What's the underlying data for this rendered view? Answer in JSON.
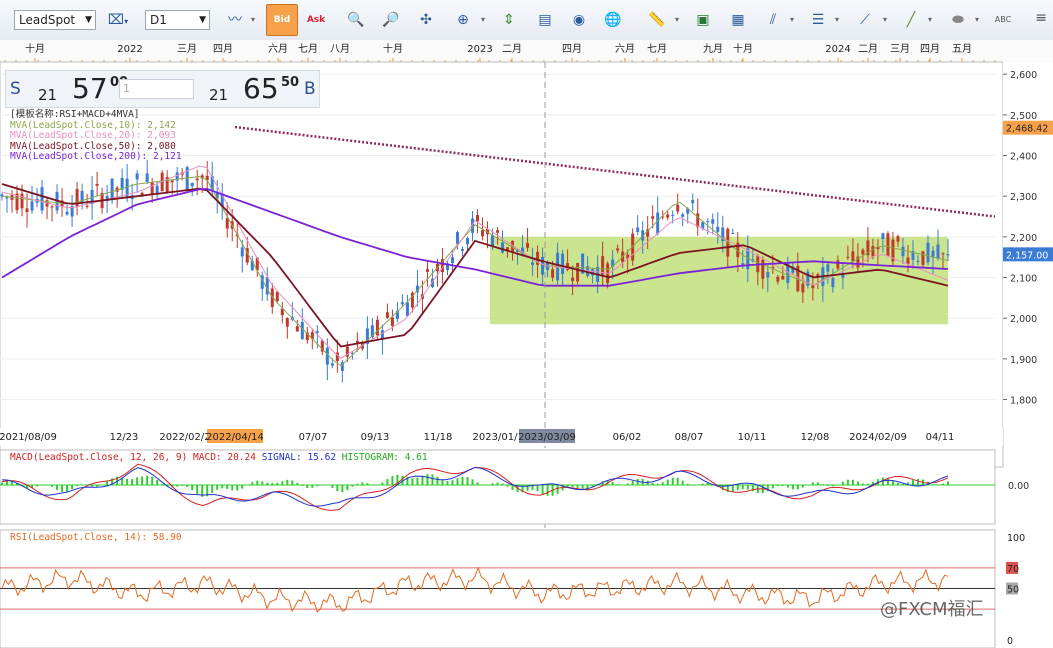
{
  "toolbar": {
    "symbol": "LeadSpot",
    "timeframe": "D1",
    "bid_label": "Bid",
    "ask_label": "Ask",
    "icons": [
      "symbol-combo",
      "draw-combo",
      "line-chart-icon",
      "bid-button",
      "ask-button",
      "zoom-in-icon",
      "zoom-out-icon",
      "crosshair-icon",
      "indicator-icon",
      "navigate-icon",
      "template-icon",
      "eye-icon",
      "globe-icon",
      "ruler-icon",
      "image-icon",
      "snapshot-icon",
      "trendline-icon",
      "hline-icon",
      "fib-icon",
      "line-icon",
      "ellipse-icon",
      "text-icon",
      "menu-icon"
    ]
  },
  "quote": {
    "sell_label": "S",
    "sell_small": "21",
    "sell_big": "57",
    "sell_sup": "00",
    "qty_placeholder": "1",
    "buy_small": "21",
    "buy_big": "65",
    "buy_sup": "50",
    "buy_label": "B"
  },
  "top_axis": [
    "十月",
    "2022",
    "三月",
    "四月",
    "六月",
    "七月",
    "八月",
    "十月",
    "2023",
    "二月",
    "四月",
    "六月",
    "七月",
    "九月",
    "十月",
    "2024",
    "二月",
    "三月",
    "四月",
    "五月"
  ],
  "price_legend": {
    "template": "[模板名称:RSI+MACD+4MVA]",
    "mva10": "MVA(LeadSpot.Close,10): 2,142",
    "mva20": "MVA(LeadSpot.Close,20): 2,093",
    "mva50": "MVA(LeadSpot.Close,50): 2,080",
    "mva200": "MVA(LeadSpot.Close,200): 2,121"
  },
  "bottom_axis": [
    "2021/08/09",
    "12/23",
    "2022/02/2",
    "2022/04/14",
    "07/07",
    "09/13",
    "11/18",
    "2023/01/",
    "2023/03/09",
    "06/02",
    "08/07",
    "10/11",
    "12/08",
    "2024/02/09",
    "04/11"
  ],
  "macd_legend": {
    "name": "MACD(LeadSpot.Close, 12, 26, 9)",
    "macd": "MACD: 20.24",
    "signal": "SIGNAL: 15.62",
    "histogram": "HISTOGRAM: 4.61"
  },
  "rsi_legend": "RSI(LeadSpot.Close, 14): 58.90",
  "watermark": "@FXCM福汇",
  "colors": {
    "mva10": "#8aa84a",
    "mva20": "#e98fbf",
    "mva50": "#7a1422",
    "mva200": "#7a22d6",
    "box": "#c2e07a",
    "trend": "#8a2b5b",
    "up": "#3a7bd5",
    "down": "#c0392b",
    "macd": "#d42020",
    "signal": "#2233cc",
    "hist": "#2ecc2e",
    "rsi": "#e06a20",
    "last_price": "#f7a24a"
  },
  "chart_data": [
    {
      "type": "line",
      "title": "",
      "x": [
        "2021/08/09",
        "2021/12/23",
        "2022/02/2",
        "2022/04/14",
        "2022/07/07",
        "2022/09/13",
        "2022/11/18",
        "2023/01/",
        "2023/03/09",
        "2023/06/02",
        "2023/08/07",
        "2023/10/11",
        "2023/12/08",
        "2024/02/09",
        "2024/04/11"
      ],
      "series": [
        {
          "name": "MVA(LeadSpot.Close,10)",
          "values": [
            2300,
            2280,
            2330,
            2350,
            2050,
            1880,
            2040,
            2230,
            2130,
            2120,
            2290,
            2150,
            2080,
            2180,
            2142
          ]
        },
        {
          "name": "MVA(LeadSpot.Close,20)",
          "values": [
            2310,
            2270,
            2310,
            2380,
            2080,
            1900,
            2000,
            2240,
            2130,
            2110,
            2250,
            2170,
            2080,
            2160,
            2093
          ]
        },
        {
          "name": "MVA(LeadSpot.Close,50)",
          "values": [
            2330,
            2280,
            2300,
            2320,
            2150,
            1930,
            1960,
            2190,
            2140,
            2100,
            2160,
            2180,
            2100,
            2120,
            2080
          ]
        },
        {
          "name": "MVA(LeadSpot.Close,200)",
          "values": [
            2100,
            2200,
            2280,
            2320,
            2260,
            2200,
            2150,
            2120,
            2080,
            2080,
            2110,
            2130,
            2140,
            2130,
            2121
          ]
        }
      ],
      "yticks": [
        1800,
        1900,
        2000,
        2100,
        2200,
        2300,
        2400,
        2500,
        2600
      ],
      "ylim": [
        1730,
        2630
      ],
      "last_price": "2,468.42",
      "current_price": "2,157.00"
    },
    {
      "type": "line",
      "title": "",
      "series": [
        {
          "name": "MACD",
          "values": [
            10,
            -40,
            60,
            -60,
            -20,
            -70,
            30,
            50,
            -30,
            10,
            40,
            -20,
            -30,
            10,
            20.24
          ]
        },
        {
          "name": "SIGNAL",
          "values": [
            5,
            -30,
            40,
            -40,
            -30,
            -60,
            10,
            40,
            -10,
            5,
            30,
            -5,
            -30,
            0,
            15.62
          ]
        }
      ],
      "yticks": [
        "0.00"
      ]
    },
    {
      "type": "line",
      "title": "",
      "series": [
        {
          "name": "RSI",
          "values": [
            50,
            60,
            45,
            55,
            40,
            35,
            55,
            60,
            45,
            50,
            55,
            45,
            40,
            55,
            58.9
          ]
        }
      ],
      "yticks": [
        "100",
        "70",
        "50",
        "0"
      ],
      "ylim": [
        0,
        100
      ]
    }
  ]
}
